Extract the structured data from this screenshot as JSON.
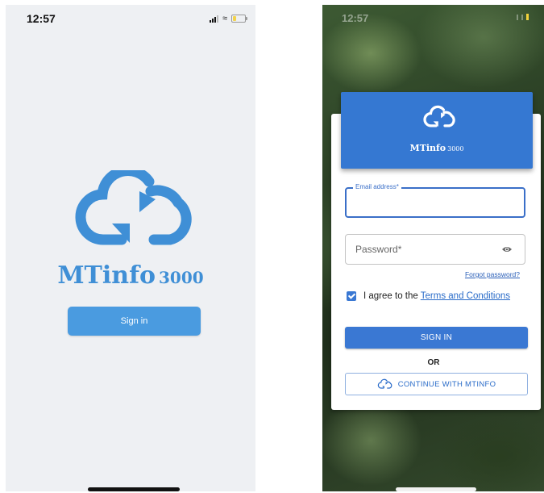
{
  "left_screen": {
    "status": {
      "time": "12:57"
    },
    "brand": {
      "name": "MTinfo",
      "number": "3000"
    },
    "signin_label": "Sign in"
  },
  "right_screen": {
    "status": {
      "time": "12:57"
    },
    "brand": {
      "name": "MTinfo",
      "number": "3000"
    },
    "email": {
      "label": "Email address*",
      "value": ""
    },
    "password": {
      "placeholder": "Password*"
    },
    "forgot_label": "Forgot password?",
    "agree": {
      "prefix": "I agree to the",
      "link": "Terms and Conditions",
      "checked": true
    },
    "signin_label": "SIGN IN",
    "or_label": "OR",
    "mtinfo_label": "CONTINUE WITH MTINFO"
  },
  "colors": {
    "brand_blue": "#3f8fd6",
    "button_blue": "#3a78d3",
    "banner_blue": "#3578d2",
    "battery_yellow": "#f2d34c"
  },
  "icons": [
    "cloud-sync-icon",
    "signal-icon",
    "wifi-icon",
    "battery-icon",
    "eye-icon",
    "checkbox-icon"
  ]
}
